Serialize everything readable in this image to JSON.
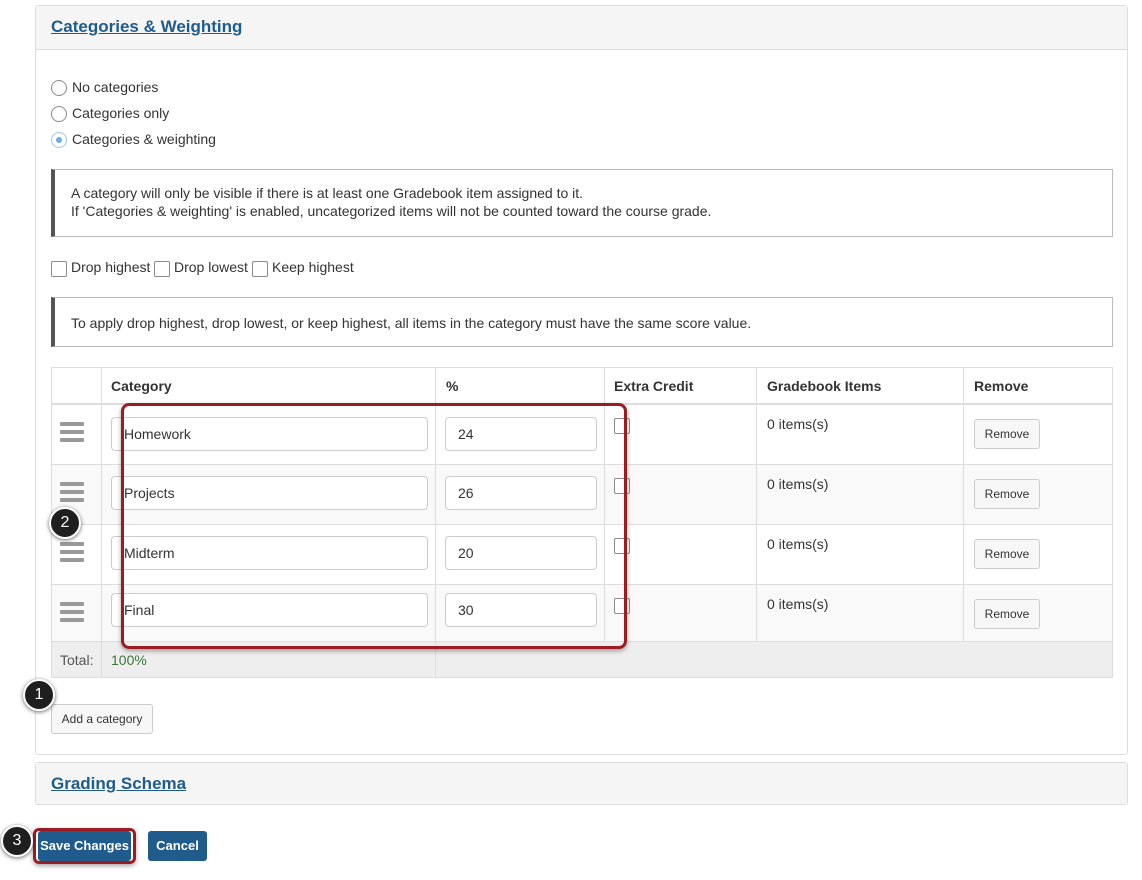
{
  "categories_panel": {
    "title": "Categories & Weighting",
    "radios": [
      {
        "label": "No categories",
        "checked": false
      },
      {
        "label": "Categories only",
        "checked": false
      },
      {
        "label": "Categories & weighting",
        "checked": true
      }
    ],
    "info1": [
      "A category will only be visible if there is at least one Gradebook item assigned to it.",
      "If 'Categories & weighting' is enabled, uncategorized items will not be counted toward the course grade."
    ],
    "drop_options": [
      {
        "label": "Drop highest",
        "checked": false
      },
      {
        "label": "Drop lowest",
        "checked": false
      },
      {
        "label": "Keep highest",
        "checked": false
      }
    ],
    "info2": "To apply drop highest, drop lowest, or keep highest, all items in the category must have the same score value.",
    "table": {
      "headers": {
        "category": "Category",
        "percent": "%",
        "extra_credit": "Extra Credit",
        "gradebook_items": "Gradebook Items",
        "remove": "Remove"
      },
      "rows": [
        {
          "category": "Homework",
          "percent": "24",
          "extra_credit": false,
          "items": "0 items(s)",
          "remove": "Remove"
        },
        {
          "category": "Projects",
          "percent": "26",
          "extra_credit": false,
          "items": "0 items(s)",
          "remove": "Remove"
        },
        {
          "category": "Midterm",
          "percent": "20",
          "extra_credit": false,
          "items": "0 items(s)",
          "remove": "Remove"
        },
        {
          "category": "Final",
          "percent": "30",
          "extra_credit": false,
          "items": "0 items(s)",
          "remove": "Remove"
        }
      ],
      "total_label": "Total:",
      "total_value": "100%"
    },
    "add_button": "Add a category"
  },
  "grading_panel": {
    "title": "Grading Schema"
  },
  "actions": {
    "save": "Save Changes",
    "cancel": "Cancel"
  },
  "callouts": [
    "1",
    "2",
    "3"
  ],
  "colors": {
    "link": "#1f5c8c",
    "highlight": "#9b1c24",
    "total": "#3c763d",
    "primary": "#1f5c8c"
  }
}
